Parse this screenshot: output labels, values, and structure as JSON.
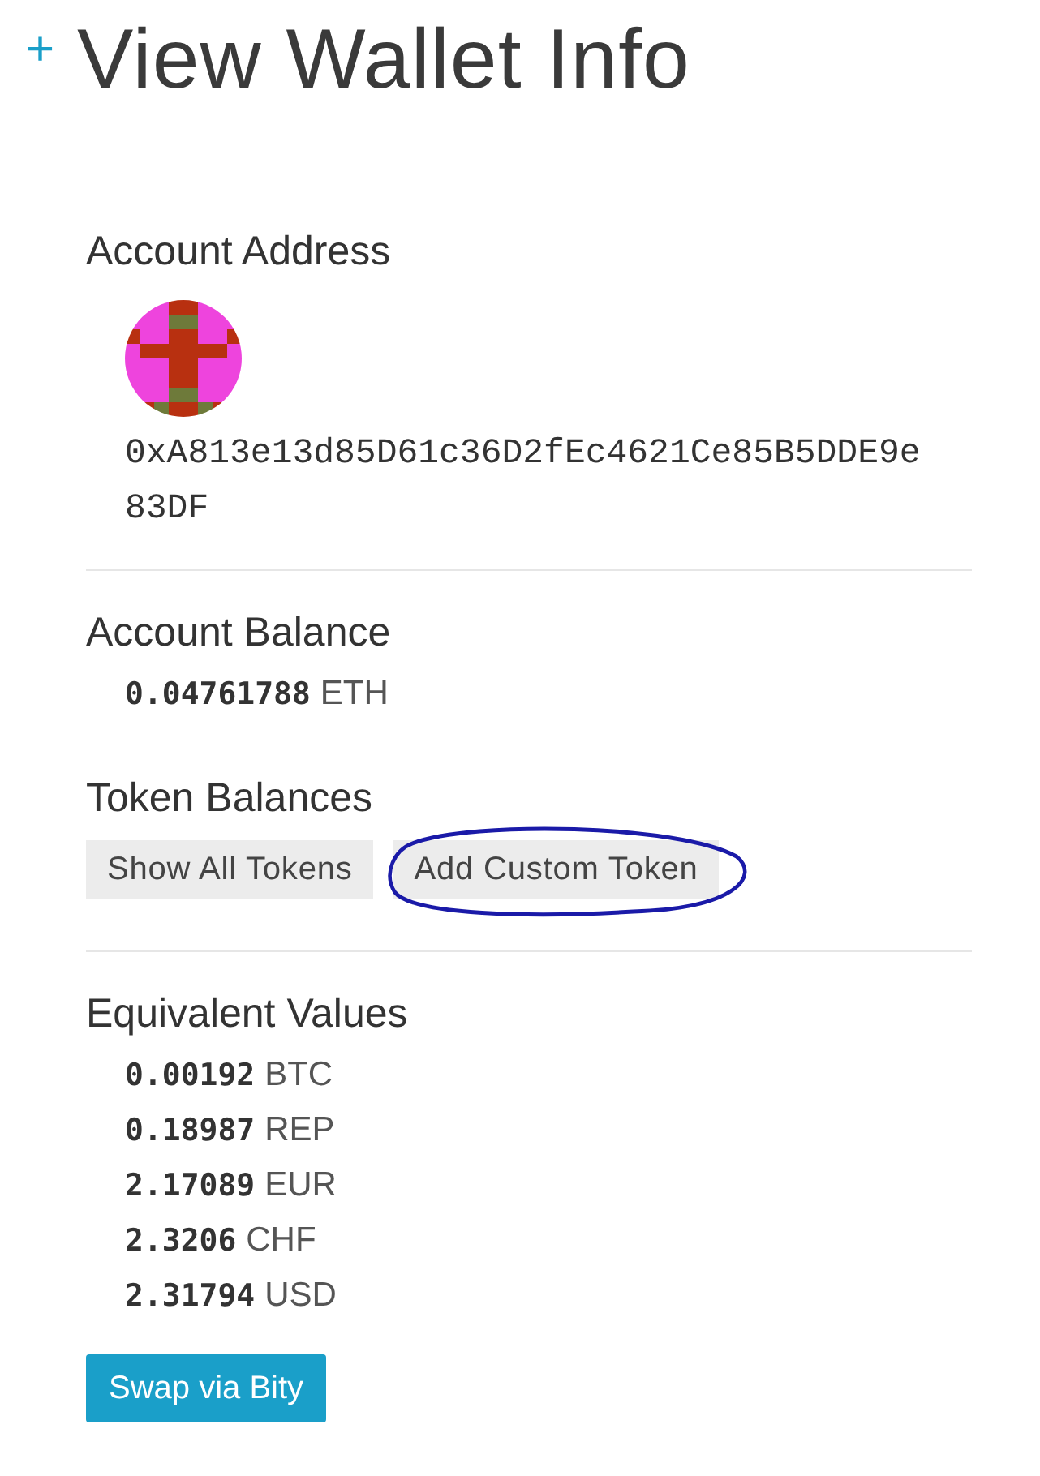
{
  "title": {
    "icon": "+",
    "text": "View Wallet Info"
  },
  "account_address": {
    "heading": "Account Address",
    "address": "0xA813e13d85D61c36D2fEc4621Ce85B5DDE9e83DF"
  },
  "account_balance": {
    "heading": "Account Balance",
    "amount": "0.04761788",
    "unit": "ETH"
  },
  "token_balances": {
    "heading": "Token Balances",
    "buttons": [
      {
        "label": "Show All Tokens",
        "circled": false
      },
      {
        "label": "Add Custom Token",
        "circled": true
      }
    ]
  },
  "equivalent_values": {
    "heading": "Equivalent Values",
    "rows": [
      {
        "amount": "0.00192",
        "unit": "BTC"
      },
      {
        "amount": "0.18987",
        "unit": "REP"
      },
      {
        "amount": "2.17089",
        "unit": "EUR"
      },
      {
        "amount": "2.3206",
        "unit": "CHF"
      },
      {
        "amount": "2.31794",
        "unit": "USD"
      }
    ],
    "swap_button": "Swap via Bity"
  }
}
